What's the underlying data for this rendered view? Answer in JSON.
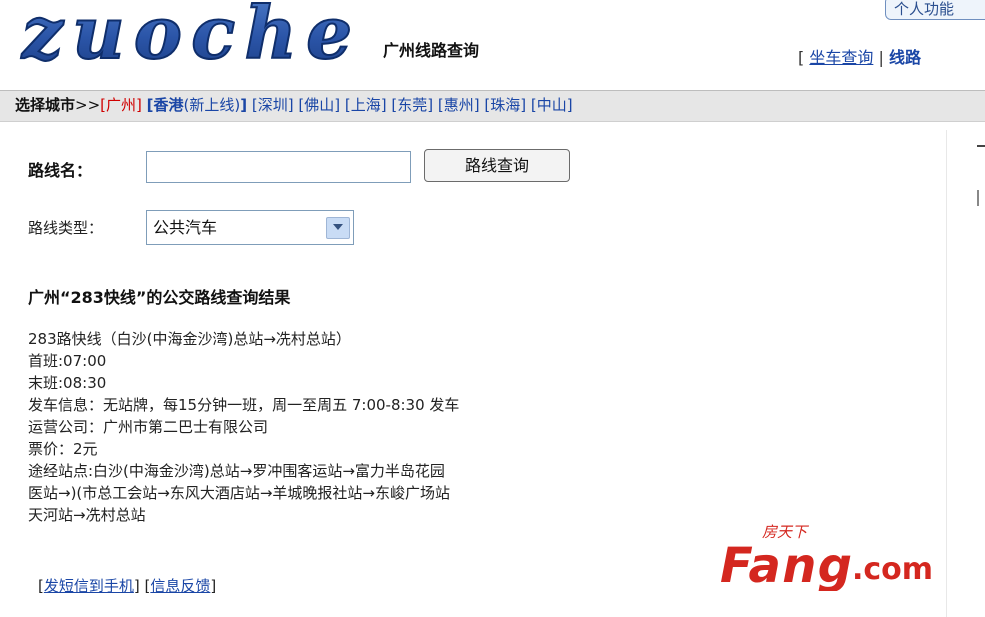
{
  "header": {
    "logo_text": "zuoche",
    "title": "广州线路查询",
    "personal_tab": "个人功能",
    "links": {
      "open": "[",
      "car_query": "坐车查询",
      "sep": "|",
      "line_query": "线路"
    }
  },
  "city_bar": {
    "lead": "选择城市",
    "arrow": ">>",
    "items": [
      {
        "label": "[广州]"
      },
      {
        "label": "[香港",
        "note": "(新上线)",
        "close": "]"
      },
      {
        "label": "[深圳]"
      },
      {
        "label": "[佛山]"
      },
      {
        "label": "[上海]"
      },
      {
        "label": "[东莞]"
      },
      {
        "label": "[惠州]"
      },
      {
        "label": "[珠海]"
      },
      {
        "label": "[中山]"
      }
    ]
  },
  "form": {
    "route_name_label": "路线名：",
    "route_name_value": "",
    "query_button": "路线查询",
    "route_type_label": "路线类型：",
    "route_type_value": "公共汽车"
  },
  "result": {
    "title": "广州“283快线”的公交路线查询结果",
    "lines": [
      "283路快线（白沙(中海金沙湾)总站→冼村总站）",
      "首班:07:00",
      "末班:08:30",
      "发车信息：无站牌，每15分钟一班，周一至周五 7:00-8:30 发车",
      "运营公司：广州市第二巴士有限公司",
      "票价：2元",
      "途经站点:白沙(中海金沙湾)总站→罗冲围客运站→富力半岛花园",
      "医站→)(市总工会站→东风大酒店站→羊城晚报社站→东峻广场站",
      "天河站→冼村总站"
    ],
    "links": [
      {
        "label": "发短信到手机"
      },
      {
        "label": "信息反馈"
      }
    ]
  },
  "watermark": {
    "text_top": "房天下",
    "brand": "Fang",
    "suffix": ".com"
  },
  "colors": {
    "link_blue": "#1a46a6",
    "city_bar_bg": "#e6e6e6",
    "highlight_red": "#d00000",
    "fang_red": "#d4271f"
  }
}
